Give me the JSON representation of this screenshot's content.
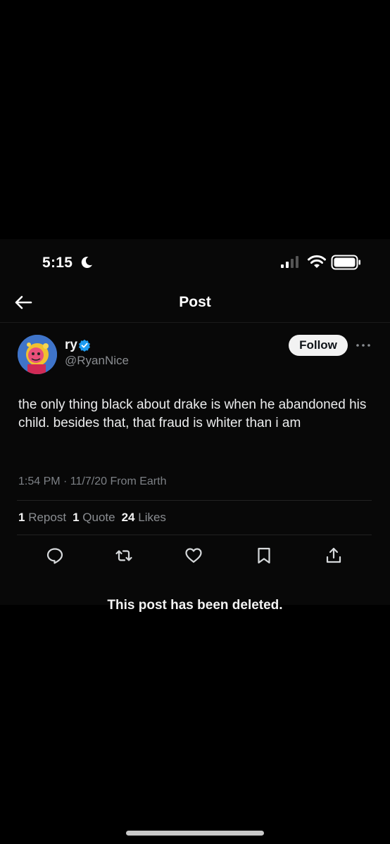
{
  "status_bar": {
    "time": "5:15",
    "icons": [
      "moon-icon",
      "signal-icon",
      "wifi-icon",
      "battery-icon"
    ]
  },
  "header": {
    "back_icon": "back-arrow-icon",
    "title": "Post"
  },
  "post": {
    "author": {
      "name": "ry",
      "handle": "@RyanNice",
      "verified": true,
      "follow_label": "Follow"
    },
    "text": "the only thing black about drake is when he abandoned his child. besides that, that fraud is whiter than i am",
    "meta": "1:54 PM · 11/7/20 From Earth",
    "stats": {
      "reposts_count": "1",
      "reposts_label": "Repost",
      "quotes_count": "1",
      "quotes_label": "Quote",
      "likes_count": "24",
      "likes_label": "Likes"
    },
    "actions": [
      "reply-icon",
      "repost-icon",
      "like-icon",
      "bookmark-icon",
      "share-icon"
    ]
  },
  "notice": "This post has been deleted.",
  "colors": {
    "background": "#000000",
    "verified": "#1d9bf0",
    "text": "#e7e9ea",
    "secondary_text": "#8a8d91"
  }
}
